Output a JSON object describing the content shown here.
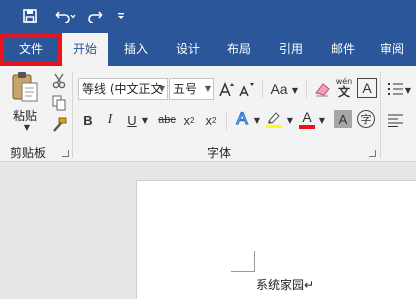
{
  "quick_access": {
    "save_icon": "save-icon",
    "undo_icon": "undo-icon",
    "redo_icon": "redo-icon",
    "customize_icon": "customize-qat-icon"
  },
  "tabs": [
    {
      "label": "文件"
    },
    {
      "label": "开始"
    },
    {
      "label": "插入"
    },
    {
      "label": "设计"
    },
    {
      "label": "布局"
    },
    {
      "label": "引用"
    },
    {
      "label": "邮件"
    },
    {
      "label": "审阅"
    }
  ],
  "clipboard": {
    "paste_label": "粘贴",
    "group_label": "剪贴板"
  },
  "font": {
    "font_name": "等线 (中文正文",
    "font_size": "五号",
    "group_label": "字体",
    "phonetic_label": "wén"
  },
  "document": {
    "text": "系统家园↵"
  },
  "colors": {
    "accent": "#2b579a",
    "highlight_border": "#e8141d",
    "font_color_bar": "#e8141d",
    "highlighter_bar": "#ffff00"
  }
}
